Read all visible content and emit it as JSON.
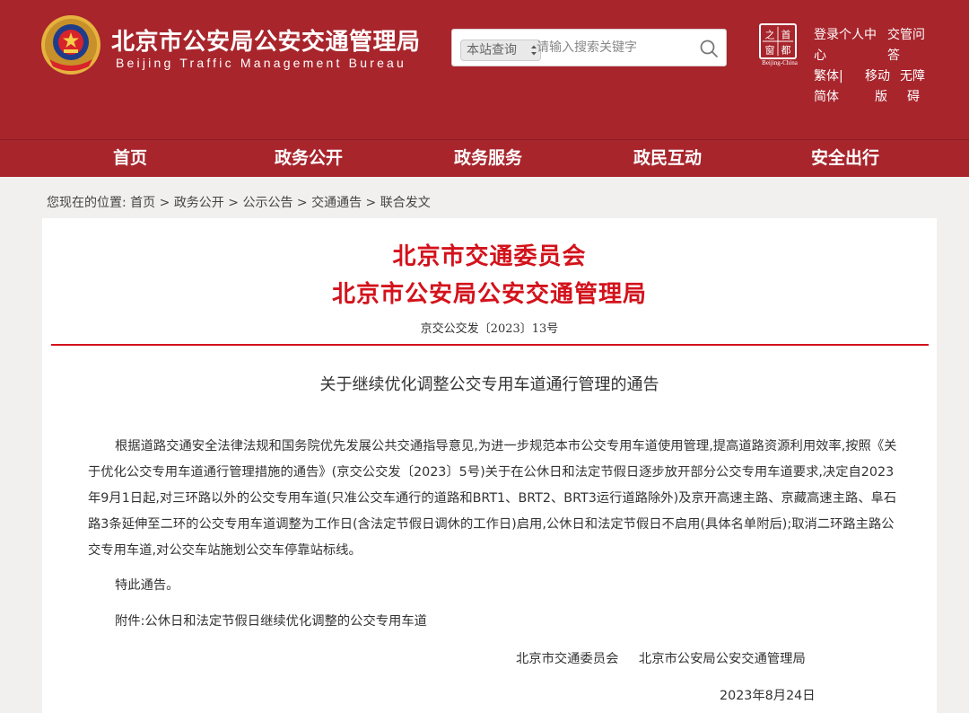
{
  "header": {
    "site_title": "北京市公安局公安交通管理局",
    "site_subtitle": "Beijing Traffic Management Bureau",
    "search": {
      "scope": "本站查询",
      "placeholder": "请输入搜索关键字",
      "icon": "search-icon"
    },
    "seal": {
      "chars": [
        "之",
        "首",
        "窗",
        "都"
      ],
      "caption": "Beijing-China"
    },
    "quick_links": [
      {
        "label": "登录个人中心",
        "lines": [
          "登录个人中",
          "心"
        ]
      },
      {
        "label": "交管问答",
        "lines": [
          "交管问",
          "答"
        ]
      },
      {
        "label": "繁体|简体",
        "lines": [
          "繁体|",
          "简体"
        ]
      },
      {
        "label": "移动版",
        "lines": [
          "移动",
          "版"
        ]
      },
      {
        "label": "无障碍",
        "lines": [
          "无障",
          "碍"
        ]
      }
    ]
  },
  "nav": {
    "items": [
      "首页",
      "政务公开",
      "政务服务",
      "政民互动",
      "安全出行"
    ]
  },
  "breadcrumb": {
    "prefix": "您现在的位置:",
    "items": [
      "首页",
      "政务公开",
      "公示公告",
      "交通通告",
      "联合发文"
    ],
    "separator": ">"
  },
  "notice": {
    "issuer_1": "北京市交通委员会",
    "issuer_2": "北京市公安局公安交通管理局",
    "doc_number": "京交公交发〔2023〕13号",
    "title": "关于继续优化调整公交专用车道通行管理的通告",
    "body": "根据道路交通安全法律法规和国务院优先发展公共交通指导意见,为进一步规范本市公交专用车道使用管理,提高道路资源利用效率,按照《关于优化公交专用车道通行管理措施的通告》(京交公交发〔2023〕5号)关于在公休日和法定节假日逐步放开部分公交专用车道要求,决定自2023年9月1日起,对三环路以外的公交专用车道(只准公交车通行的道路和BRT1、BRT2、BRT3运行道路除外)及京开高速主路、京藏高速主路、阜石路3条延伸至二环的公交专用车道调整为工作日(含法定节假日调休的工作日)启用,公休日和法定节假日不启用(具体名单附后);取消二环路主路公交专用车道,对公交车站施划公交车停靠站标线。",
    "closing": "特此通告。",
    "attachment": "附件:公休日和法定节假日继续优化调整的公交专用车道",
    "signatories": [
      "北京市交通委员会",
      "北京市公安局公安交通管理局"
    ],
    "date": "2023年8月24日"
  },
  "colors": {
    "brand_red": "#a8252c",
    "title_red": "#d3121b",
    "page_bg": "#f1f0ef"
  }
}
